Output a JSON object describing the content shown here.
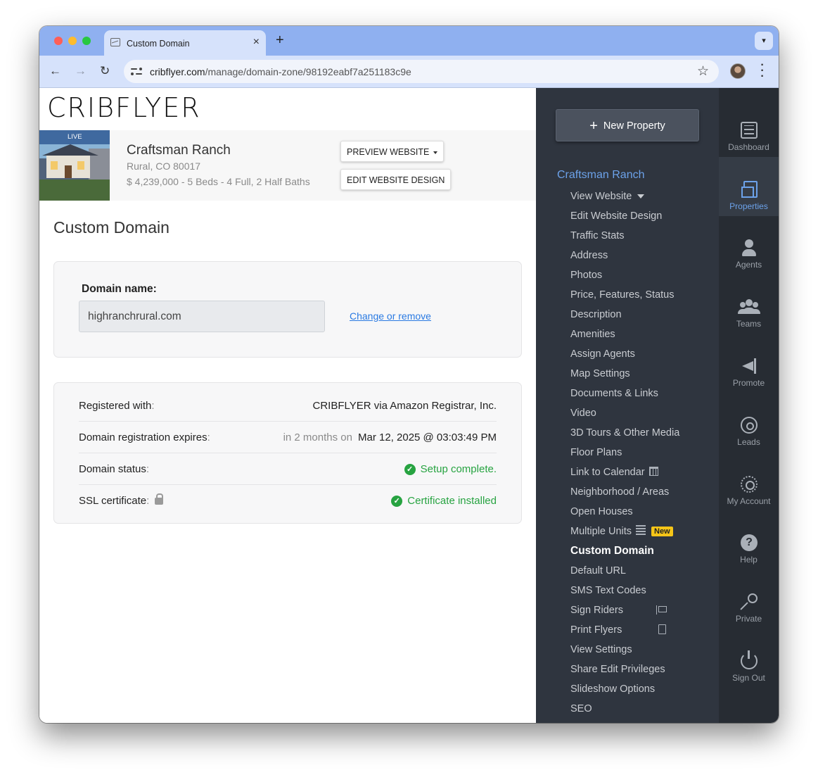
{
  "browser": {
    "tab_title": "Custom Domain",
    "url_domain": "cribflyer.com",
    "url_path": "/manage/domain-zone/98192eabf7a251183c9e"
  },
  "app": {
    "logo": "CRIBFLYER"
  },
  "property": {
    "badge": "LIVE",
    "name": "Craftsman Ranch",
    "address": "Rural, CO 80017",
    "details": "$ 4,239,000 - 5 Beds - 4 Full, 2 Half Baths",
    "preview_button": "PREVIEW WEBSITE",
    "edit_button": "EDIT WEBSITE DESIGN"
  },
  "page": {
    "title": "Custom Domain",
    "domain_label": "Domain name:",
    "domain_value": "highranchrural.com",
    "change_link": "Change or remove",
    "rows": [
      {
        "label": "Registered with",
        "muted": "",
        "value": "CRIBFLYER via Amazon Registrar, Inc.",
        "status": "plain"
      },
      {
        "label": "Domain registration expires",
        "muted": "in 2 months on",
        "value": "Mar 12, 2025 @ 03:03:49 PM",
        "status": "plain"
      },
      {
        "label": "Domain status",
        "muted": "",
        "value": "Setup complete.",
        "status": "ok"
      },
      {
        "label": "SSL certificate",
        "muted": "",
        "value": "Certificate installed",
        "status": "ok"
      }
    ]
  },
  "subnav": {
    "new_property": "New Property",
    "property_title": "Craftsman Ranch",
    "items": [
      "View Website",
      "Edit Website Design",
      "Traffic Stats",
      "Address",
      "Photos",
      "Price, Features, Status",
      "Description",
      "Amenities",
      "Assign Agents",
      "Map Settings",
      "Documents & Links",
      "Video",
      "3D Tours & Other Media",
      "Floor Plans",
      "Link to Calendar",
      "Neighborhood / Areas",
      "Open Houses",
      "Multiple Units",
      "Custom Domain",
      "Default URL",
      "SMS Text Codes",
      "Sign Riders",
      "Print Flyers",
      "View Settings",
      "Share Edit Privileges",
      "Slideshow Options",
      "SEO"
    ],
    "new_badge": "New",
    "active_item": "Custom Domain"
  },
  "rail": {
    "items": [
      {
        "label": "Dashboard",
        "icon": "dashboard-icon"
      },
      {
        "label": "Properties",
        "icon": "properties-icon"
      },
      {
        "label": "Agents",
        "icon": "agent-icon"
      },
      {
        "label": "Teams",
        "icon": "teams-icon"
      },
      {
        "label": "Promote",
        "icon": "megaphone-icon"
      },
      {
        "label": "Leads",
        "icon": "target-icon"
      },
      {
        "label": "My Account",
        "icon": "gear-icon"
      },
      {
        "label": "Help",
        "icon": "help-icon"
      },
      {
        "label": "Private",
        "icon": "key-icon"
      },
      {
        "label": "Sign Out",
        "icon": "power-icon"
      }
    ],
    "active": "Properties"
  },
  "colors": {
    "accent": "#6ca2ea",
    "success": "#27a341",
    "link": "#2a7ae2",
    "sidebar_bg": "#2f353f",
    "rail_bg": "#272c33"
  }
}
